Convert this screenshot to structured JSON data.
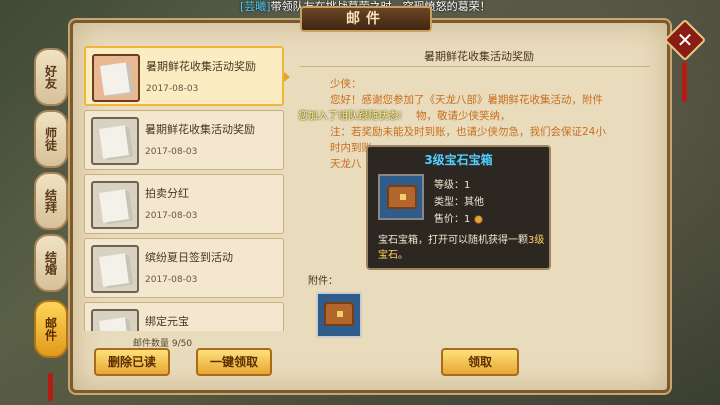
{
  "notice": {
    "tag": "[芸曦]",
    "text": "带领队友在挑战葛荣之时，突现愤怒的葛荣！"
  },
  "window": {
    "title": "邮件"
  },
  "tabs": [
    {
      "label": "好友"
    },
    {
      "label": "师徒"
    },
    {
      "label": "结拜"
    },
    {
      "label": "结婚"
    },
    {
      "label": "邮件"
    }
  ],
  "mails": [
    {
      "subject": "暑期鲜花收集活动奖励",
      "date": "2017-08-03"
    },
    {
      "subject": "暑期鲜花收集活动奖励",
      "date": "2017-08-03"
    },
    {
      "subject": "拍卖分红",
      "date": "2017-08-03"
    },
    {
      "subject": "缤纷夏日签到活动",
      "date": "2017-08-03"
    },
    {
      "subject": "绑定元宝",
      "date": ""
    }
  ],
  "mail_count": "邮件数量 9/50",
  "buttons": {
    "delete_read": "删除已读",
    "claim_all": "一键领取",
    "claim": "领取"
  },
  "detail": {
    "title": "暑期鲜花收集活动奖励",
    "greeting": "少侠：",
    "line1": "您好！感谢您参加了《天龙八部》暑期鲜花收集活动，附件",
    "line2": "物，敬请少侠笑纳，",
    "line3": "注：若奖励未能及时到账，也请少侠勿急，我们会保证24小",
    "line4": "时内到账",
    "sign": "天龙八",
    "team_status": "您加入了组队跟随状态!",
    "attachment_label": "附件："
  },
  "tooltip": {
    "title": "3级宝石宝箱",
    "level": "等级：1",
    "type": "类型：其他",
    "price": "售价：1",
    "desc_pre": "宝石宝箱，打开可以随机获得一颗",
    "desc_hl": "3级宝石",
    "desc_post": "。"
  }
}
